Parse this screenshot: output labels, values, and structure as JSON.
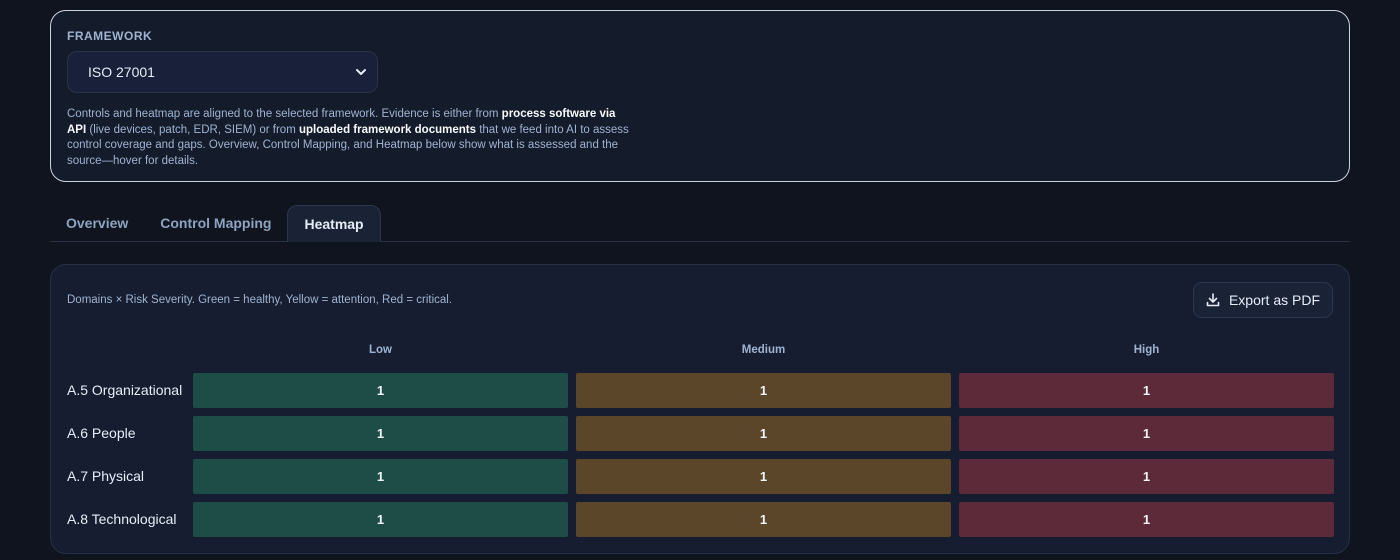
{
  "framework": {
    "label": "FRAMEWORK",
    "selected": "ISO 27001",
    "description_parts": [
      {
        "text": "Controls and heatmap are aligned to the selected framework. Evidence is either from ",
        "bold": false
      },
      {
        "text": "process software via API",
        "bold": true
      },
      {
        "text": " (live devices, patch, EDR, SIEM) or from ",
        "bold": false
      },
      {
        "text": "uploaded framework documents",
        "bold": true
      },
      {
        "text": " that we feed into AI to assess control coverage and gaps. Overview, Control Mapping, and Heatmap below show what is assessed and the source—hover for details.",
        "bold": false
      }
    ]
  },
  "tabs": [
    {
      "label": "Overview",
      "active": false
    },
    {
      "label": "Control Mapping",
      "active": false
    },
    {
      "label": "Heatmap",
      "active": true
    }
  ],
  "heatmap": {
    "caption": "Domains × Risk Severity. Green = healthy, Yellow = attention, Red = critical.",
    "export_label": "Export as PDF",
    "columns": [
      "Low",
      "Medium",
      "High"
    ],
    "column_colors": [
      "#1e4d48",
      "#5c4629",
      "#5c2a38"
    ],
    "rows": [
      {
        "label": "A.5 Organizational",
        "values": [
          "1",
          "1",
          "1"
        ]
      },
      {
        "label": "A.6 People",
        "values": [
          "1",
          "1",
          "1"
        ]
      },
      {
        "label": "A.7 Physical",
        "values": [
          "1",
          "1",
          "1"
        ]
      },
      {
        "label": "A.8 Technological",
        "values": [
          "1",
          "1",
          "1"
        ]
      }
    ]
  }
}
